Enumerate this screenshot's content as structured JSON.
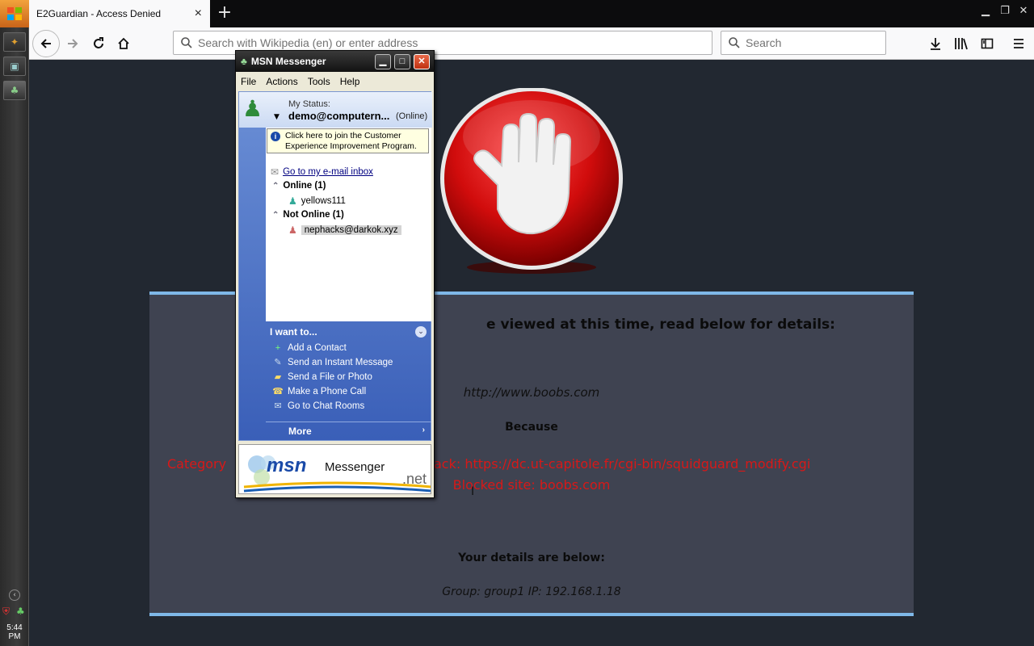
{
  "taskbar": {
    "clock": "5:44 PM"
  },
  "browser": {
    "tab_title": "E2Guardian - Access Denied",
    "tab_close": "×",
    "new_tab": "+",
    "url_placeholder": "Search with Wikipedia (en) or enter address",
    "search_placeholder": "Search"
  },
  "page": {
    "heading_partial": "e viewed at this time, read below for details:",
    "blocked_url": "http://www.boobs.com",
    "because_label": "Because",
    "category_line_left": "Category",
    "category_line_right": "ack: https://dc.ut-capitole.fr/cgi-bin/squidguard_modify.cgi",
    "blocked_site": "Blocked site: boobs.com",
    "details_label": "Your details are below:",
    "group_ip": "Group: group1   IP: 192.168.1.18"
  },
  "msn": {
    "title": "MSN Messenger",
    "menu": [
      "File",
      "Actions",
      "Tools",
      "Help"
    ],
    "status_label": "My Status:",
    "status_name": "demo@computern...",
    "status_state": "(Online)",
    "tip": "Click here to join the Customer Experience Improvement Program.",
    "inbox_link": "Go to my e-mail inbox",
    "online_group": "Online (1)",
    "online_contact": "yellows111",
    "offline_group": "Not Online (1)",
    "offline_contact": "nephacks@darkok.xyz",
    "iwant_title": "I want to...",
    "actions": [
      "Add a Contact",
      "Send an Instant Message",
      "Send a File or Photo",
      "Make a Phone Call",
      "Go to Chat Rooms"
    ],
    "more": "More",
    "ad_brand": "msn",
    "ad_product": "Messenger",
    "ad_net": ".net"
  }
}
